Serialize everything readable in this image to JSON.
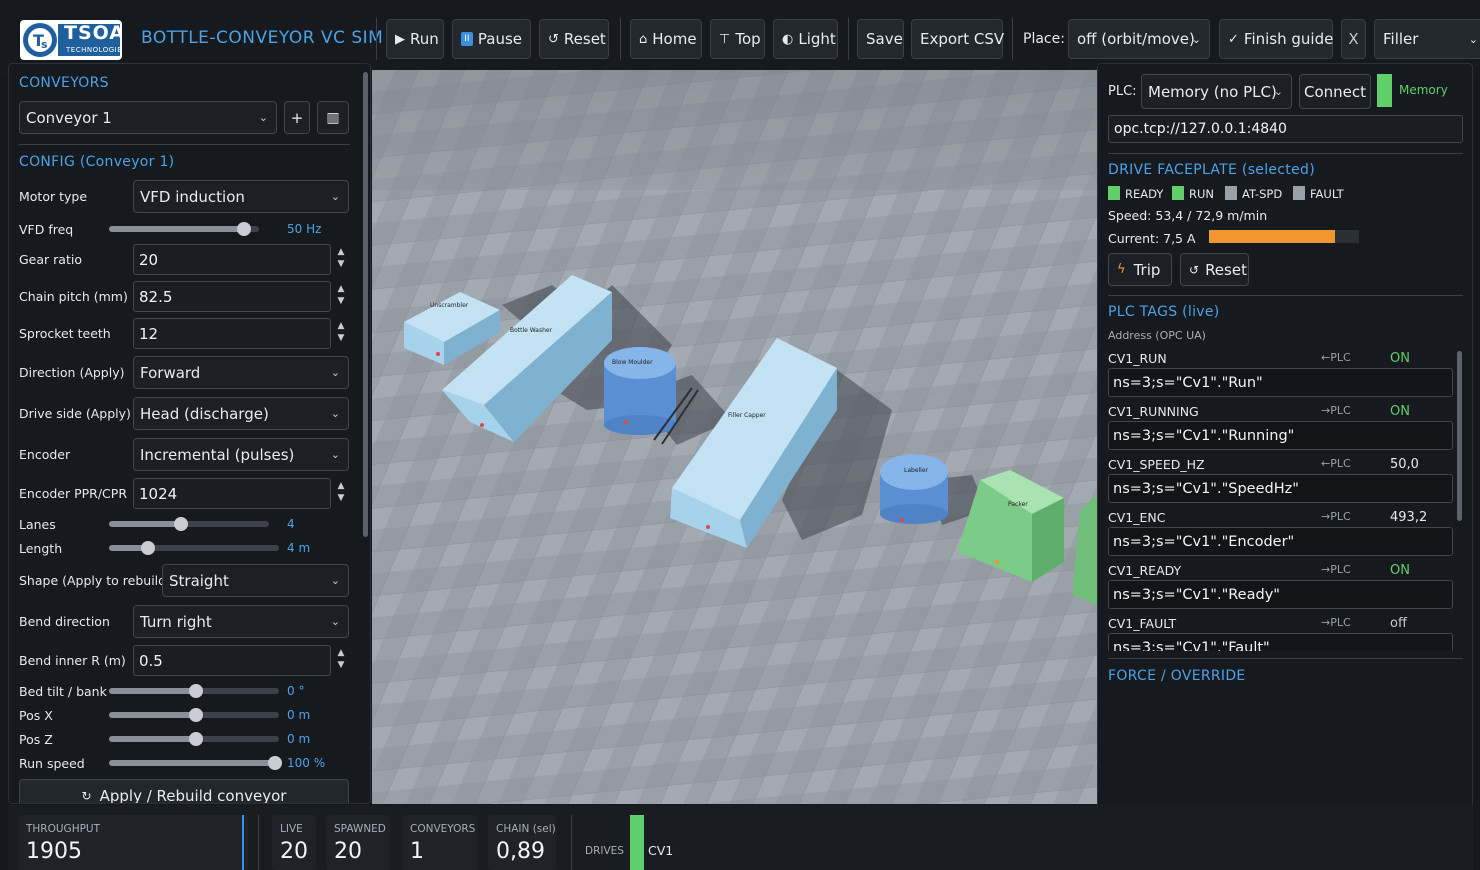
{
  "app": {
    "title": "BOTTLE-CONVEYOR  VC SIM",
    "logo_text": "TSOA",
    "logo_sub": "TECHNOLOGIES"
  },
  "toolbar": {
    "run": "Run",
    "pause": "Pause",
    "reset": "Reset",
    "home": "Home",
    "top": "Top",
    "light": "Light",
    "save": "Save",
    "export": "Export CSV",
    "place_label": "Place:",
    "place_value": "off (orbit/move)",
    "finish_guide": "Finish guide",
    "close": "X",
    "filler": "Filler"
  },
  "left": {
    "conveyors_title": "CONVEYORS",
    "conveyor_select": "Conveyor 1",
    "add": "+",
    "config_title": "CONFIG  (Conveyor 1)",
    "motor_type": {
      "label": "Motor type",
      "value": "VFD induction"
    },
    "vfd_freq": {
      "label": "VFD freq",
      "value": "50 Hz",
      "level": 0.9
    },
    "gear_ratio": {
      "label": "Gear ratio",
      "value": "20"
    },
    "chain_pitch": {
      "label": "Chain pitch (mm)",
      "value": "82.5"
    },
    "sprocket": {
      "label": "Sprocket teeth",
      "value": "12"
    },
    "direction": {
      "label": "Direction (Apply)",
      "value": "Forward"
    },
    "drive_side": {
      "label": "Drive side (Apply)",
      "value": "Head (discharge)"
    },
    "encoder": {
      "label": "Encoder",
      "value": "Incremental (pulses)"
    },
    "encoder_ppr": {
      "label": "Encoder PPR/CPR",
      "value": "1024"
    },
    "lanes": {
      "label": "Lanes",
      "value": "4",
      "level": 0.45
    },
    "length": {
      "label": "Length",
      "value": "4 m",
      "level": 0.23
    },
    "shape": {
      "label": "Shape (Apply to rebuild)",
      "value": "Straight"
    },
    "bend_dir": {
      "label": "Bend direction",
      "value": "Turn right"
    },
    "bend_r": {
      "label": "Bend inner R (m)",
      "value": "0.5"
    },
    "bed_tilt": {
      "label": "Bed tilt / bank",
      "value": "0 °",
      "level": 0.51
    },
    "pos_x": {
      "label": "Pos X",
      "value": "0 m",
      "level": 0.51
    },
    "pos_z": {
      "label": "Pos Z",
      "value": "0 m",
      "level": 0.51
    },
    "run_speed": {
      "label": "Run speed",
      "value": "100 %",
      "level": 1.0
    },
    "apply": "Apply / Rebuild conveyor"
  },
  "scene": {
    "labels": [
      "Unscrambler",
      "Bottle Washer",
      "Blow Moulder",
      "Filler Capper",
      "Labeller",
      "Packer"
    ]
  },
  "right": {
    "plc_label": "PLC:",
    "plc_select": "Memory (no PLC)",
    "connect": "Connect",
    "plc_status": "Memory",
    "endpoint": "opc.tcp://127.0.0.1:4840",
    "faceplate_title": "DRIVE FACEPLATE  (selected)",
    "leds": [
      {
        "name": "READY",
        "color": "#5fd06b"
      },
      {
        "name": "RUN",
        "color": "#5fd06b"
      },
      {
        "name": "AT-SPD",
        "color": "#9aa0a8"
      },
      {
        "name": "FAULT",
        "color": "#9aa0a8"
      }
    ],
    "speed_line": "Speed:  53,4  /  72,9  m/min",
    "current_label": "Current:  7,5  A",
    "current_level": 0.84,
    "trip": "Trip",
    "reset": "Reset",
    "tags_title": "PLC TAGS  (live)",
    "address_label": "Address (OPC UA)",
    "tags": [
      {
        "name": "CV1_RUN",
        "dir": "←PLC",
        "value": "ON",
        "addr": "ns=3;s=\"Cv1\".\"Run\""
      },
      {
        "name": "CV1_RUNNING",
        "dir": "→PLC",
        "value": "ON",
        "addr": "ns=3;s=\"Cv1\".\"Running\""
      },
      {
        "name": "CV1_SPEED_HZ",
        "dir": "←PLC",
        "value": "50,0",
        "addr": "ns=3;s=\"Cv1\".\"SpeedHz\""
      },
      {
        "name": "CV1_ENC",
        "dir": "→PLC",
        "value": "493,2",
        "addr": "ns=3;s=\"Cv1\".\"Encoder\""
      },
      {
        "name": "CV1_READY",
        "dir": "→PLC",
        "value": "ON",
        "addr": "ns=3;s=\"Cv1\".\"Ready\""
      },
      {
        "name": "CV1_FAULT",
        "dir": "→PLC",
        "value": "off",
        "addr": "ns=3;s=\"Cv1\".\"Fault\""
      }
    ],
    "force_title": "FORCE / OVERRIDE"
  },
  "bottom": {
    "throughput": {
      "label": "THROUGHPUT",
      "value": "1905"
    },
    "live": {
      "label": "LIVE",
      "value": "20"
    },
    "spawned": {
      "label": "SPAWNED",
      "value": "20"
    },
    "conveyors": {
      "label": "CONVEYORS",
      "value": "1"
    },
    "chain": {
      "label": "CHAIN (sel)",
      "value": "0,89"
    },
    "drives_label": "DRIVES",
    "drive_name": "CV1"
  },
  "colors": {
    "accent": "#4aa3e8",
    "ok": "#5fd06b",
    "warn": "#f0962e",
    "machine_blue": "#a9d4ec",
    "machine_green": "#8fd59a"
  }
}
